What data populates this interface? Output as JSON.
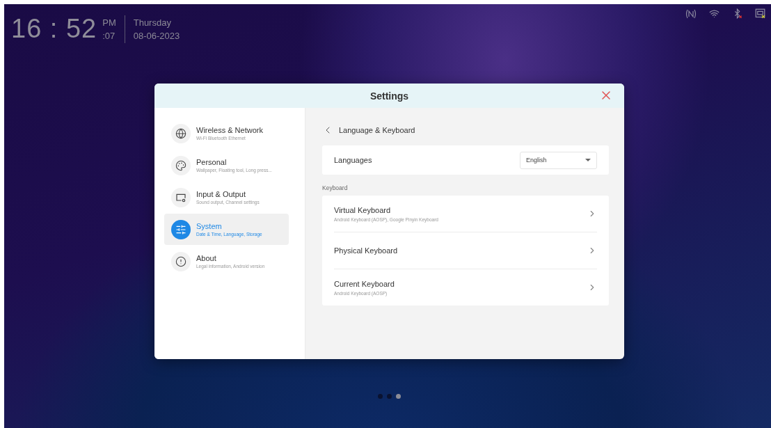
{
  "clock": {
    "time": "16 : 52",
    "period": "PM",
    "seconds": ":07",
    "day": "Thursday",
    "date": "08-06-2023"
  },
  "window": {
    "title": "Settings"
  },
  "sidebar": {
    "items": [
      {
        "label": "Wireless & Network",
        "description": "Wi-Fi Bluetooth Ethernet",
        "selected": false
      },
      {
        "label": "Personal",
        "description": "Wallpaper, Floating tool, Long press...",
        "selected": false
      },
      {
        "label": "Input & Output",
        "description": "Sound output, Channel settings",
        "selected": false
      },
      {
        "label": "System",
        "description": "Date & Time, Language, Storage",
        "selected": true
      },
      {
        "label": "About",
        "description": "Legal information, Android version",
        "selected": false
      }
    ]
  },
  "page": {
    "title": "Language & Keyboard",
    "languages": {
      "label": "Languages",
      "value": "English"
    },
    "section_label": "Keyboard",
    "keyboard_rows": [
      {
        "title": "Virtual Keyboard",
        "subtitle": "Android Keyboard (AOSP), Google Pinyin Keyboard"
      },
      {
        "title": "Physical Keyboard"
      },
      {
        "title": "Current Keyboard",
        "subtitle": "Android Keyboard (AOSP)"
      }
    ]
  },
  "page_indicator": [
    {
      "selected": false
    },
    {
      "selected": false
    },
    {
      "selected": true
    }
  ]
}
